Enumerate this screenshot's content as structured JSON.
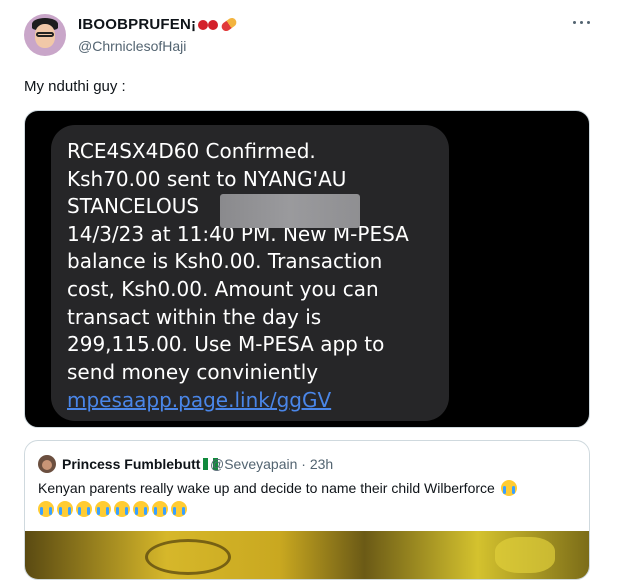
{
  "post": {
    "display_name": "IBOOBPRUFEN¡",
    "name_emoji_icons": [
      "cherries-emoji",
      "pill-emoji"
    ],
    "handle": "@ChrniclesofHaji",
    "text": "My nduthi guy :"
  },
  "media": {
    "sms_lines": [
      "RCE4SX4D60 Confirmed.",
      "Ksh70.00 sent to NYANG'AU",
      "STANCELOUS                    on",
      "14/3/23 at 11:40 PM. New M-PESA",
      "balance is Ksh0.00. Transaction",
      "cost, Ksh0.00. Amount you can",
      "transact within the day is",
      "299,115.00. Use M-PESA app to",
      "send money conviniently"
    ],
    "sms_link": "mpesaapp.page.link/ggGV",
    "bubble_color": "#262628",
    "link_color": "#4a86e8"
  },
  "quoted": {
    "display_name": "Princess Fumblebutt",
    "name_emoji_icons": [
      "nigeria-flag-emoji"
    ],
    "handle": "@Seveyapain · 23h",
    "text": "Kenyan parents really wake up and decide to name their child Wilberforce",
    "trailing_emoji": "loudly-crying-face-emoji",
    "emoji_row_count": 8
  },
  "colors": {
    "text_primary": "#0f1419",
    "text_secondary": "#536471",
    "border": "#cfd9de"
  }
}
